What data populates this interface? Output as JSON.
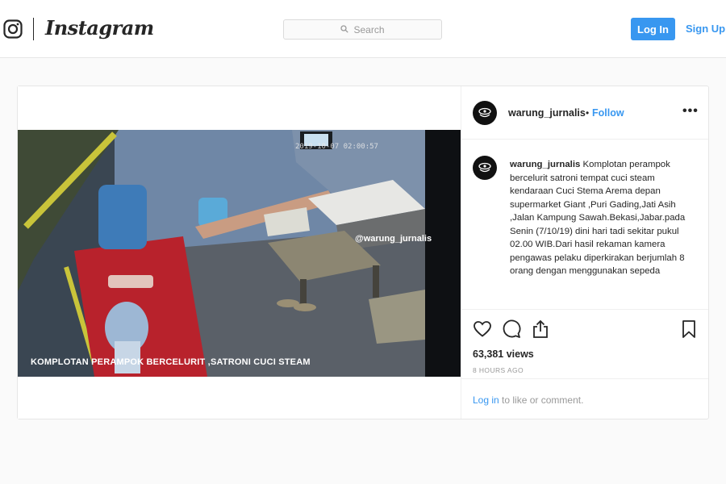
{
  "header": {
    "brand": "Instagram",
    "search_placeholder": "Search",
    "login_label": "Log In",
    "signup_label": "Sign Up",
    "icons": {
      "logo": "instagram-camera-icon",
      "search": "search-icon"
    },
    "accent_color": "#3897f0"
  },
  "post": {
    "username": "warung_jurnalis",
    "follow_separator": "•",
    "follow_label": "Follow",
    "more_label": "•••",
    "video": {
      "timestamp_overlay": "2019-10-07 02:00:57",
      "watermark": "@warung_jurnalis",
      "caption_overlay": "KOMPLOTAN PERAMPOK BERCELURIT ,SATRONI CUCI STEAM"
    },
    "comment": {
      "username": "warung_jurnalis",
      "text": "Komplotan perampok bercelurit satroni tempat cuci steam kendaraan Cuci Stema Arema depan supermarket Giant ,Puri Gading,Jati Asih ,Jalan Kampung Sawah.Bekasi,Jabar.pada Senin (7/10/19) dini hari tadi sekitar pukul 02.00 WIB.Dari hasil rekaman kamera pengawas pelaku diperkirakan berjumlah 8 orang dengan menggunakan sepeda"
    },
    "views": "63,381 views",
    "time_ago": "8 HOURS AGO",
    "actions": {
      "like_icon": "heart-icon",
      "comment_icon": "comment-bubble-icon",
      "share_icon": "share-icon",
      "save_icon": "bookmark-icon"
    },
    "footer": {
      "login_link": "Log in",
      "rest": " to like or comment."
    }
  }
}
